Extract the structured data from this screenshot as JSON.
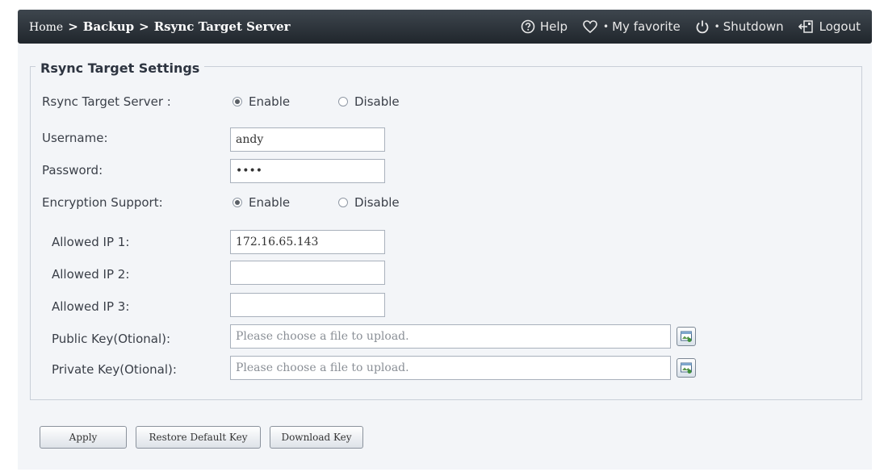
{
  "header": {
    "breadcrumb": [
      "Home",
      "Backup",
      "Rsync Target Server"
    ],
    "separator": ">",
    "help_label": "Help",
    "favorite_label": "My favorite",
    "shutdown_label": "Shutdown",
    "logout_label": "Logout",
    "bar_color": "#2a3138"
  },
  "settings": {
    "legend": "Rsync Target Settings",
    "rsync_target_server": {
      "label": "Rsync Target Server :",
      "options": [
        "Enable",
        "Disable"
      ],
      "selected": "Enable"
    },
    "username": {
      "label": "Username:",
      "value": "andy"
    },
    "password": {
      "label": "Password:",
      "value": "****"
    },
    "encryption": {
      "label": "Encryption Support:",
      "options": [
        "Enable",
        "Disable"
      ],
      "selected": "Enable"
    },
    "allowed_ip": [
      {
        "label": "Allowed IP 1:",
        "value": "172.16.65.143"
      },
      {
        "label": "Allowed IP 2:",
        "value": ""
      },
      {
        "label": "Allowed IP 3:",
        "value": ""
      }
    ],
    "public_key": {
      "label": "Public Key(Otional):",
      "placeholder": "Please choose a file to upload."
    },
    "private_key": {
      "label": "Private Key(Otional):",
      "placeholder": "Please choose a file to upload."
    }
  },
  "buttons": {
    "apply": "Apply",
    "restore": "Restore Default Key",
    "download": "Download Key"
  }
}
